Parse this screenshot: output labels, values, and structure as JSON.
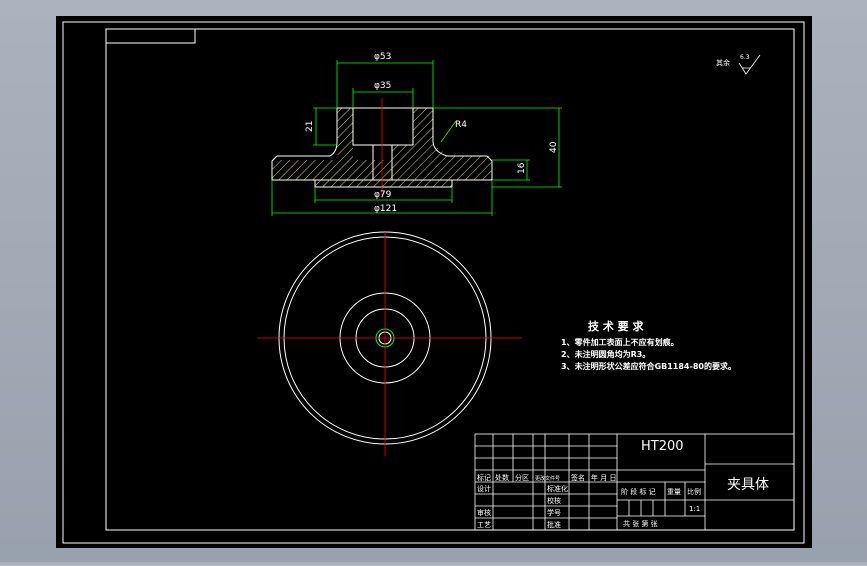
{
  "colors": {
    "viewport_bg": "#a4adb8",
    "paper": "#000000",
    "line": "#ffffff",
    "dimension": "#00ff00",
    "centerline": "#ff0000",
    "hatch": "#ffff00",
    "text": "#ffffff"
  },
  "dimensions": {
    "d53": "φ53",
    "d35": "φ35",
    "d79": "φ79",
    "d121": "φ121",
    "h21": "21",
    "h16": "16",
    "h40": "40",
    "r4": "R4"
  },
  "roughness": {
    "label": "其余",
    "value": "6.3"
  },
  "requirements": {
    "title": "技 术 要 求",
    "items": [
      "1、零件加工表面上不应有划痕。",
      "2、未注明圆角均为R3。",
      "3、未注明形状公差应符合GB1184-80的要求。"
    ]
  },
  "title_block": {
    "material": "HT200",
    "part_name": "夹具体",
    "header": [
      "标记",
      "处数",
      "分区",
      "更改文件号",
      "签名",
      "年 月 日"
    ],
    "design": "设计",
    "standardize": "标准化",
    "check": "审核",
    "process": "工艺",
    "approve": "批准",
    "stage_label": "阶 段 标 记",
    "weight": "重量",
    "scale_label": "比例",
    "scale_value": "1:1",
    "sheets": "共   张  第   张",
    "student_id": "学号",
    "checker": "校核"
  }
}
